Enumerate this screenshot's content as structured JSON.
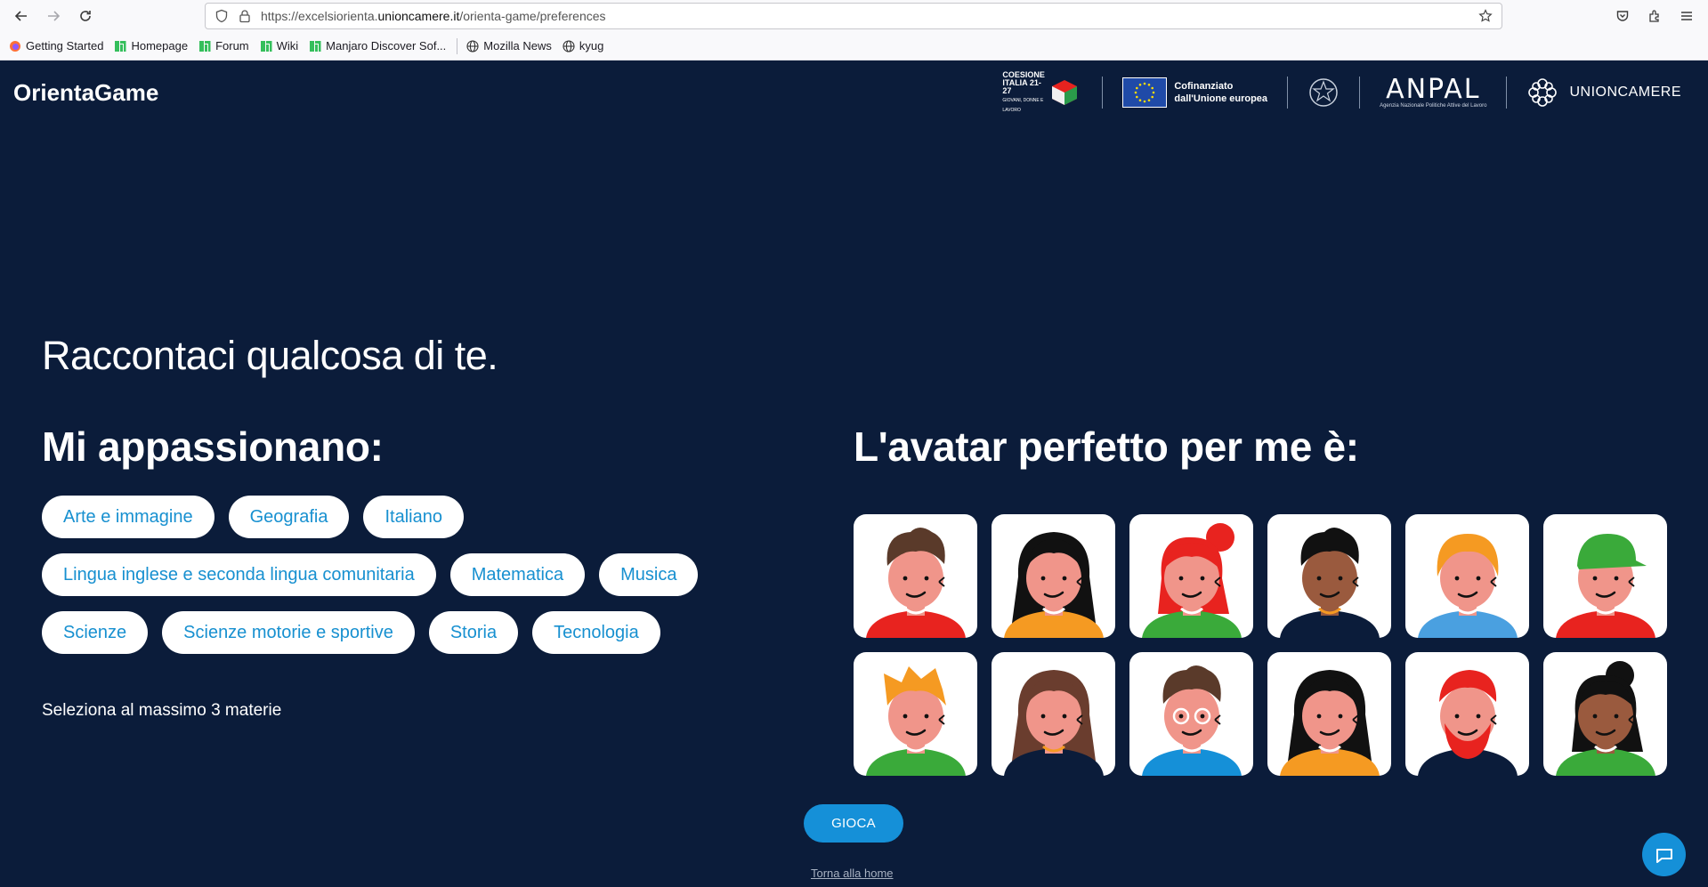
{
  "browser": {
    "url_prefix": "https://excelsiorienta.",
    "url_domain": "unioncamere.it",
    "url_path": "/orienta-game/preferences",
    "bookmarks": [
      {
        "label": "Getting Started",
        "icon": "firefox-icon"
      },
      {
        "label": "Homepage",
        "icon": "manjaro-icon"
      },
      {
        "label": "Forum",
        "icon": "manjaro-icon"
      },
      {
        "label": "Wiki",
        "icon": "manjaro-icon"
      },
      {
        "label": "Manjaro Discover Sof...",
        "icon": "manjaro-icon"
      },
      {
        "label": "Mozilla News",
        "icon": "globe-icon"
      },
      {
        "label": "kyug",
        "icon": "globe-icon"
      }
    ]
  },
  "header": {
    "brand": "OrientaGame",
    "coesione": "COESIONE ITALIA 21-27",
    "coesione_sub": "GIOVANI, DONNE E LAVORO",
    "eu_text_1": "Cofinanziato",
    "eu_text_2": "dall'Unione europea",
    "anpal": "ANPAL",
    "anpal_sub": "Agenzia Nazionale Politiche Attive del Lavoro",
    "unioncamere": "UNIONCAMERE"
  },
  "main": {
    "intro": "Raccontaci qualcosa di te.",
    "left_title": "Mi appassionano:",
    "right_title": "L'avatar perfetto per me è:",
    "subjects": [
      [
        "Arte e immagine",
        "Geografia",
        "Italiano"
      ],
      [
        "Lingua inglese e seconda lingua comunitaria",
        "Matematica",
        "Musica"
      ],
      [
        "Scienze",
        "Scienze motorie e sportive",
        "Storia",
        "Tecnologia"
      ]
    ],
    "hint": "Seleziona al massimo 3 materie",
    "play_button": "GIOCA",
    "home_link": "Torna alla home"
  },
  "avatars": [
    {
      "hair": "#5a3a2a",
      "skin": "#f0958a",
      "shirt": "#e8231f",
      "style": "curly"
    },
    {
      "hair": "#111111",
      "skin": "#f0958a",
      "shirt": "#f59a22",
      "style": "long"
    },
    {
      "hair": "#e8231f",
      "skin": "#f0958a",
      "shirt": "#3aaa3a",
      "style": "bun"
    },
    {
      "hair": "#111111",
      "skin": "#9a5a3e",
      "shirt": "#0b1c3a",
      "style": "short"
    },
    {
      "hair": "#f59a22",
      "skin": "#f0958a",
      "shirt": "#4aa0e0",
      "style": "bob"
    },
    {
      "hair": "#3aaa3a",
      "skin": "#f0958a",
      "shirt": "#e8231f",
      "style": "cap"
    },
    {
      "hair": "#f59a22",
      "skin": "#f0958a",
      "shirt": "#3aaa3a",
      "style": "spiky"
    },
    {
      "hair": "#6a3d2e",
      "skin": "#f0958a",
      "shirt": "#0b1c3a",
      "style": "long"
    },
    {
      "hair": "#5a3a2a",
      "skin": "#f0958a",
      "shirt": "#1590d8",
      "style": "curly-glasses"
    },
    {
      "hair": "#111111",
      "skin": "#f0958a",
      "shirt": "#f59a22",
      "style": "long"
    },
    {
      "hair": "#e8231f",
      "skin": "#f0958a",
      "shirt": "#0b1c3a",
      "style": "beard"
    },
    {
      "hair": "#111111",
      "skin": "#9a5a3e",
      "shirt": "#3aaa3a",
      "style": "bun"
    }
  ]
}
